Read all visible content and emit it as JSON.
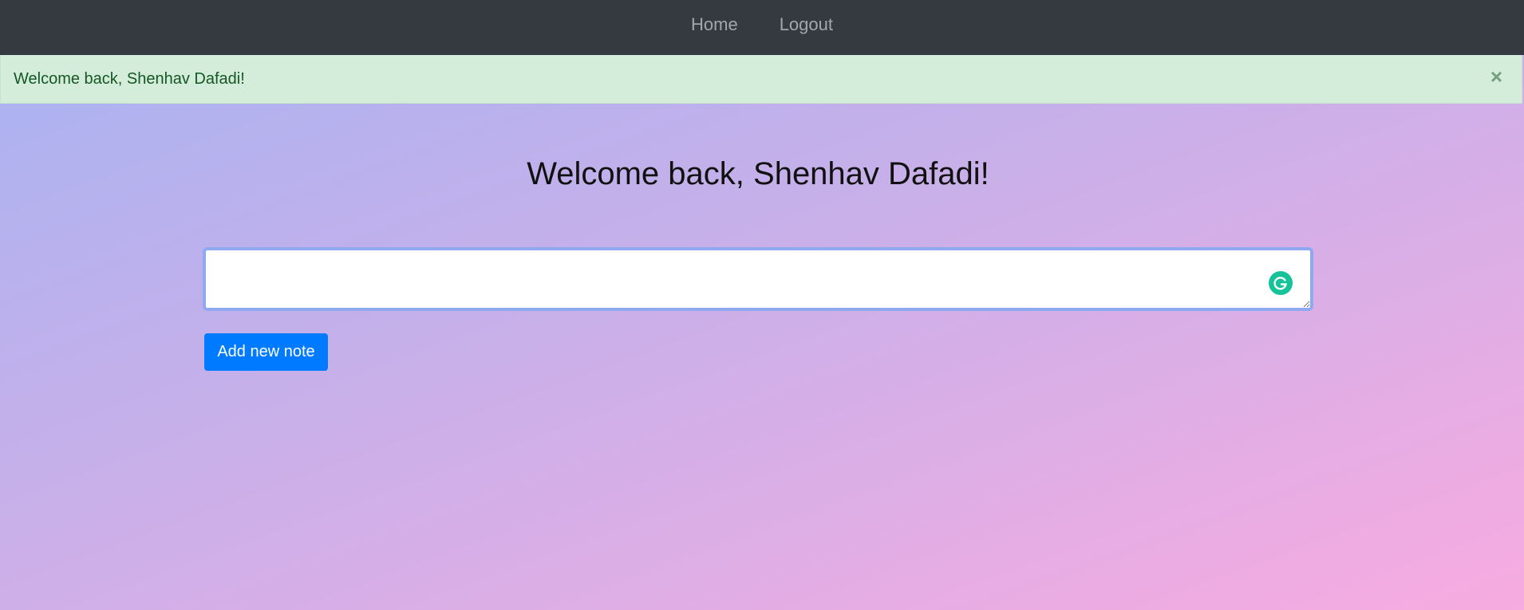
{
  "navbar": {
    "links": [
      {
        "label": "Home"
      },
      {
        "label": "Logout"
      }
    ]
  },
  "alert": {
    "message": "Welcome back, Shenhav Dafadi!",
    "close_glyph": "×",
    "color": "#155724",
    "background": "#d4ecda"
  },
  "main": {
    "title": "Welcome back, Shenhav Dafadi!",
    "note_input": {
      "value": "",
      "placeholder": ""
    },
    "add_button_label": "Add new note"
  },
  "icons": {
    "grammarly": "grammarly-icon",
    "close": "close-icon"
  },
  "colors": {
    "navbar": "#343a40",
    "primary_button": "#007bff",
    "grammarly": "#15c39a"
  }
}
